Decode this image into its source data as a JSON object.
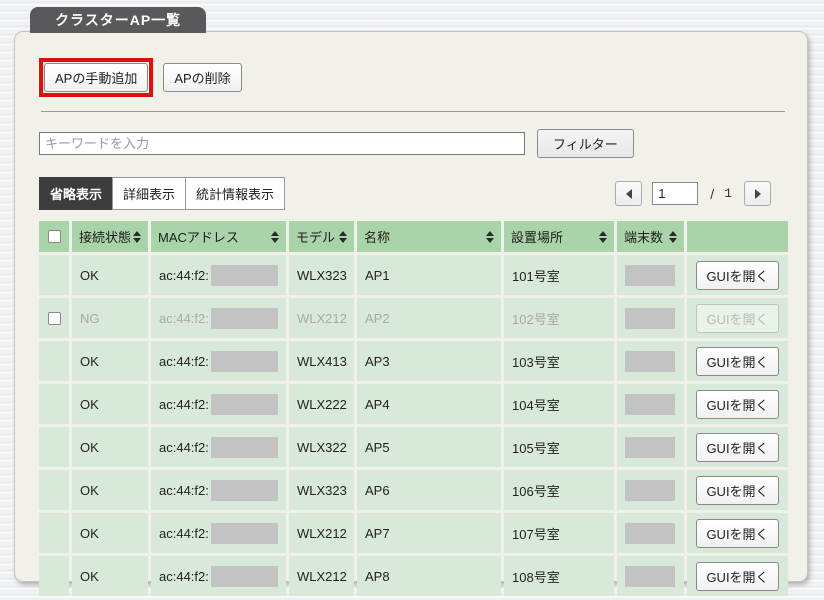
{
  "page": {
    "tab_title": "クラスターAP一覧"
  },
  "toolbar": {
    "add_button": "APの手動追加",
    "delete_button": "APの削除"
  },
  "filter": {
    "placeholder": "キーワードを入力",
    "button": "フィルター"
  },
  "view_tabs": {
    "summary": "省略表示",
    "detail": "詳細表示",
    "stats": "統計情報表示",
    "active": "省略表示"
  },
  "pagination": {
    "current": "1",
    "separator": "/",
    "total": "1"
  },
  "table": {
    "headers": {
      "status": "接続状態",
      "mac": "MACアドレス",
      "model": "モデル",
      "name": "名称",
      "location": "設置場所",
      "clients": "端末数"
    },
    "rows": [
      {
        "status": "OK",
        "mac": "ac:44:f2:",
        "model": "WLX323",
        "name": "AP1",
        "location": "101号室",
        "action": "GUIを開く",
        "state": "ok",
        "has_checkbox": false
      },
      {
        "status": "NG",
        "mac": "ac:44:f2:",
        "model": "WLX212",
        "name": "AP2",
        "location": "102号室",
        "action": "GUIを開く",
        "state": "ng",
        "has_checkbox": true
      },
      {
        "status": "OK",
        "mac": "ac:44:f2:",
        "model": "WLX413",
        "name": "AP3",
        "location": "103号室",
        "action": "GUIを開く",
        "state": "ok",
        "has_checkbox": false
      },
      {
        "status": "OK",
        "mac": "ac:44:f2:",
        "model": "WLX222",
        "name": "AP4",
        "location": "104号室",
        "action": "GUIを開く",
        "state": "ok",
        "has_checkbox": false
      },
      {
        "status": "OK",
        "mac": "ac:44:f2:",
        "model": "WLX322",
        "name": "AP5",
        "location": "105号室",
        "action": "GUIを開く",
        "state": "ok",
        "has_checkbox": false
      },
      {
        "status": "OK",
        "mac": "ac:44:f2:",
        "model": "WLX323",
        "name": "AP6",
        "location": "106号室",
        "action": "GUIを開く",
        "state": "ok",
        "has_checkbox": false
      },
      {
        "status": "OK",
        "mac": "ac:44:f2:",
        "model": "WLX212",
        "name": "AP7",
        "location": "107号室",
        "action": "GUIを開く",
        "state": "ok",
        "has_checkbox": false
      },
      {
        "status": "OK",
        "mac": "ac:44:f2:",
        "model": "WLX212",
        "name": "AP8",
        "location": "108号室",
        "action": "GUIを開く",
        "state": "ok",
        "has_checkbox": false
      }
    ]
  },
  "colors": {
    "table_header_green": "#a9d4a9",
    "table_row_green": "#d9e9d9",
    "highlight_red": "#dd0f0f",
    "tab_gray": "#59595b",
    "active_view_tab": "#3d3d3d",
    "redacted_gray": "#c3c3c3",
    "disabled_text": "#a8a8a8"
  }
}
